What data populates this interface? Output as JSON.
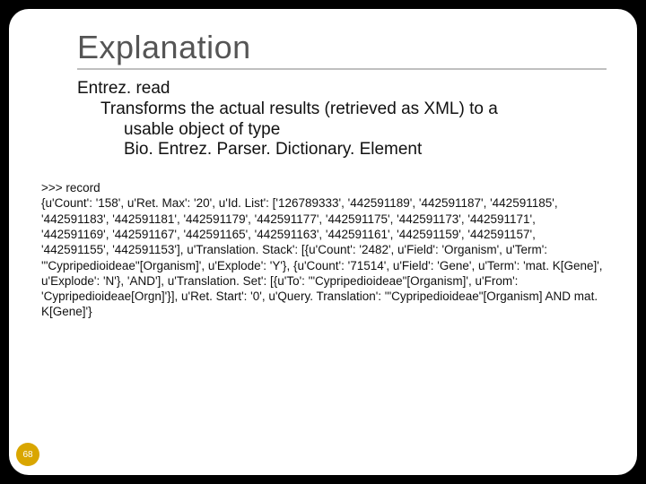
{
  "title": "Explanation",
  "desc": {
    "fn": "Entrez. read",
    "line1": "Transforms the actual results (retrieved as XML) to a",
    "line2a": "usable object of type",
    "line2b": "Bio. Entrez. Parser. Dictionary. Element"
  },
  "code": {
    "prompt": ">>> record",
    "body": "{u'Count': '158', u'Ret. Max': '20', u'Id. List': ['126789333', '442591189', '442591187', '442591185', '442591183', '442591181', '442591179', '442591177', '442591175', '442591173', '442591171', '442591169', '442591167', '442591165', '442591163', '442591161', '442591159', '442591157', '442591155', '442591153'], u'Translation. Stack': [{u'Count': '2482', u'Field': 'Organism', u'Term': '\"Cypripedioideae\"[Organism]', u'Explode': 'Y'}, {u'Count': '71514', u'Field': 'Gene', u'Term': 'mat. K[Gene]', u'Explode': 'N'}, 'AND'], u'Translation. Set': [{u'To': '\"Cypripedioideae\"[Organism]', u'From': 'Cypripedioideae[Orgn]'}], u'Ret. Start': '0', u'Query. Translation': '\"Cypripedioideae\"[Organism] AND mat. K[Gene]'}"
  },
  "pagenum": "68"
}
